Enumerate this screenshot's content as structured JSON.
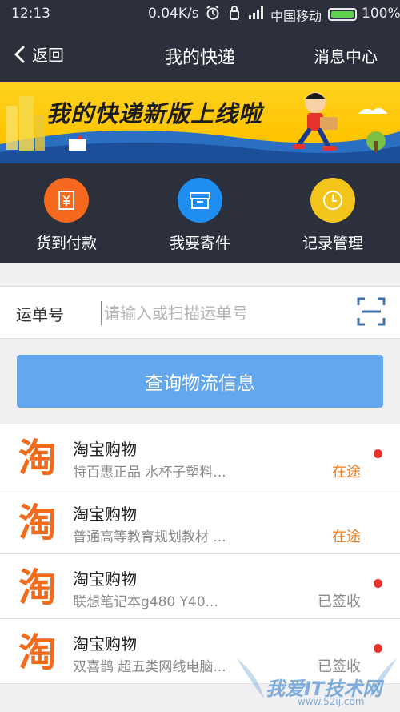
{
  "status_bar": {
    "time": "12:13",
    "speed": "0.04K/s",
    "carrier": "中国移动",
    "battery": "100%"
  },
  "nav": {
    "back_label": "返回",
    "title": "我的快递",
    "message_center": "消息中心"
  },
  "banner": {
    "text": "我的快递新版上线啦"
  },
  "quick_actions": [
    {
      "label": "货到付款",
      "icon": "yuan-receipt-icon",
      "color": "#f4691d"
    },
    {
      "label": "我要寄件",
      "icon": "box-icon",
      "color": "#1e8ff0"
    },
    {
      "label": "记录管理",
      "icon": "clock-icon",
      "color": "#f3c51a"
    }
  ],
  "tracking_form": {
    "label": "运单号",
    "placeholder": "请输入或扫描运单号",
    "value": ""
  },
  "query_button": "查询物流信息",
  "shipments": [
    {
      "name": "淘宝购物",
      "desc": "特百惠正品 水杯子塑料...",
      "status": "在途",
      "status_type": "transit",
      "unread": true
    },
    {
      "name": "淘宝购物",
      "desc": "普通高等教育规划教材 ...",
      "status": "在途",
      "status_type": "transit",
      "unread": false
    },
    {
      "name": "淘宝购物",
      "desc": "联想笔记本g480 Y40...",
      "status": "已签收",
      "status_type": "signed",
      "unread": true
    },
    {
      "name": "淘宝购物",
      "desc": "双喜鹊 超五类网线电脑...",
      "status": "已签收",
      "status_type": "signed",
      "unread": true
    }
  ],
  "logo_text": "淘",
  "watermark": {
    "text": "我爱IT技术网",
    "url": "www.52ij.com"
  },
  "colors": {
    "header_bg": "#2c2f3c",
    "accent_blue": "#63a7ee",
    "transit": "#f07b20",
    "unread_dot": "#e8322b",
    "logo_orange": "#f26b1d"
  }
}
